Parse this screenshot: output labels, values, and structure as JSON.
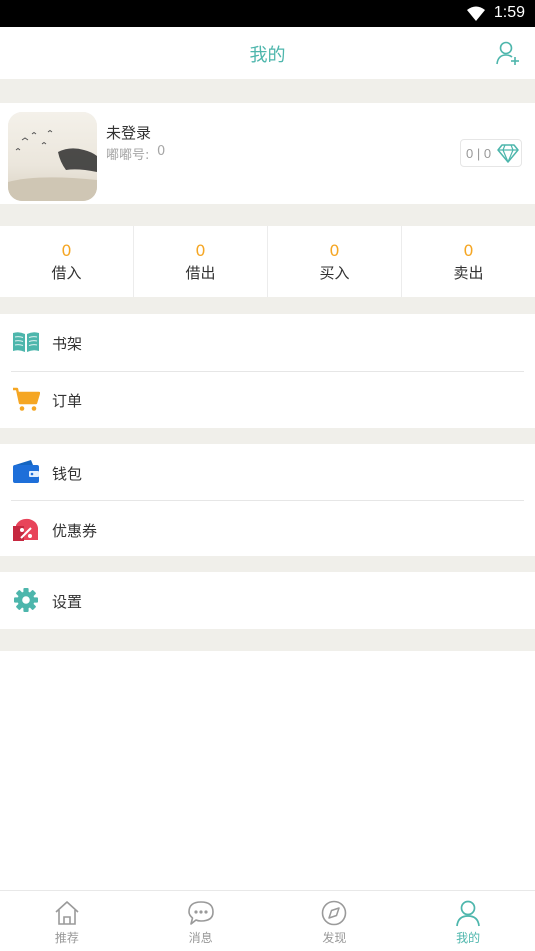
{
  "status_bar": {
    "time": "1:59"
  },
  "header": {
    "title": "我的",
    "add_user_icon": "add-user-icon"
  },
  "profile": {
    "name": "未登录",
    "dudu_label": "嘟嘟号:",
    "dudu_value": "0",
    "balance_text": "0 | 0",
    "gem_icon": "diamond-icon"
  },
  "stats": [
    {
      "value": "0",
      "label": "借入"
    },
    {
      "value": "0",
      "label": "借出"
    },
    {
      "value": "0",
      "label": "买入"
    },
    {
      "value": "0",
      "label": "卖出"
    }
  ],
  "menu_groups": [
    [
      {
        "label": "书架",
        "icon": "book-icon"
      },
      {
        "label": "订单",
        "icon": "cart-icon"
      }
    ],
    [
      {
        "label": "钱包",
        "icon": "wallet-icon"
      },
      {
        "label": "优惠券",
        "icon": "coupon-icon"
      }
    ],
    [
      {
        "label": "设置",
        "icon": "gear-icon"
      }
    ]
  ],
  "tabs": [
    {
      "label": "推荐",
      "icon": "home-icon",
      "active": false
    },
    {
      "label": "消息",
      "icon": "chat-icon",
      "active": false
    },
    {
      "label": "发现",
      "icon": "compass-icon",
      "active": false
    },
    {
      "label": "我的",
      "icon": "person-icon",
      "active": true
    }
  ],
  "colors": {
    "accent": "#4db6ac",
    "stat_number": "#f5a623",
    "background_gap": "#f0efea",
    "book_icon": "#4db6ac",
    "cart_icon": "#f5a623",
    "wallet_icon": "#1e6fd9",
    "coupon_icon": "#e8445a",
    "gear_icon": "#4db6ac"
  }
}
